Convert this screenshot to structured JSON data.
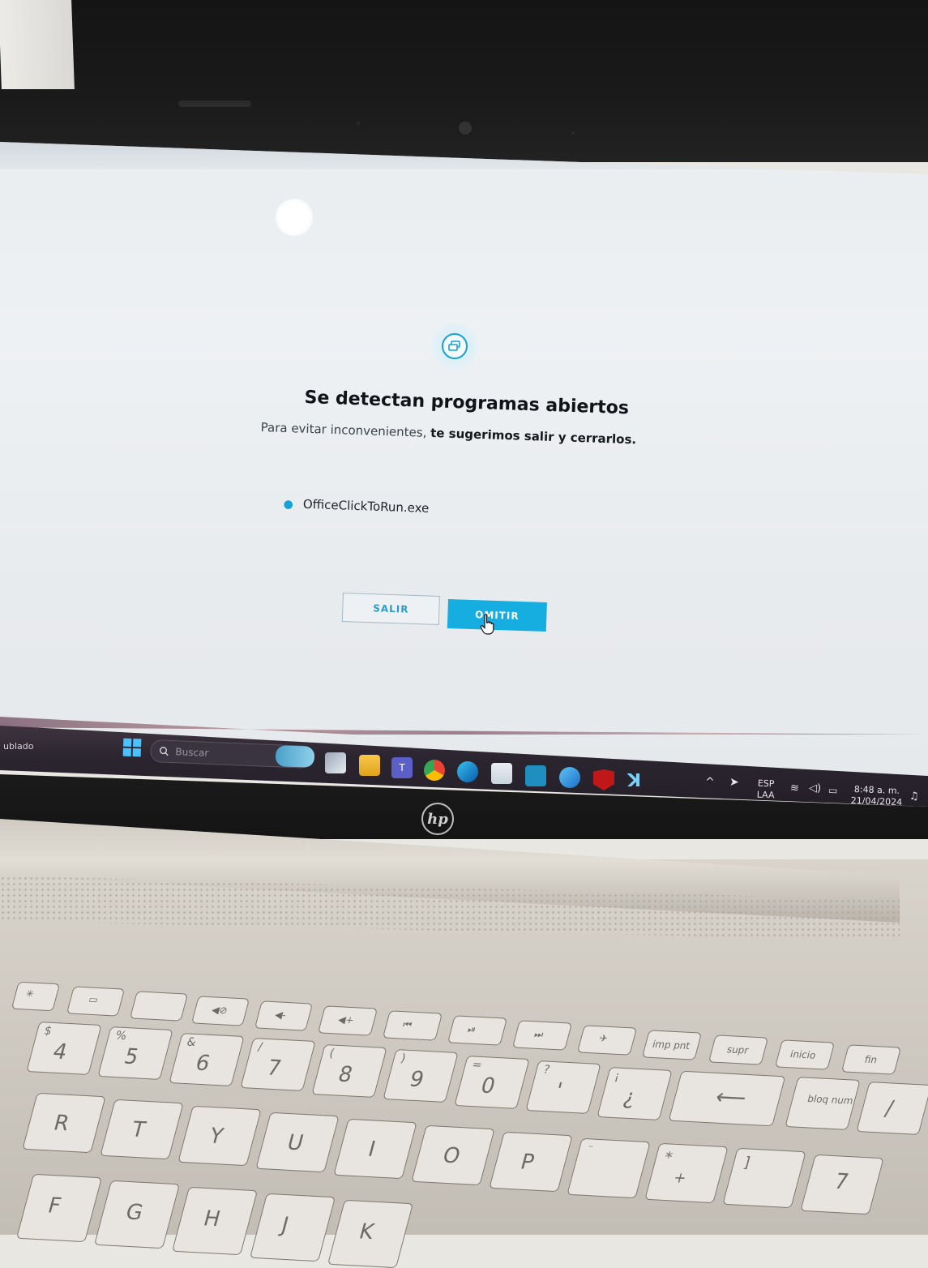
{
  "dialog": {
    "icon": "stacked-windows-icon",
    "title": "Se detectan programas abiertos",
    "subtitle_plain": "Para evitar inconvenientes,",
    "subtitle_bold": "te sugerimos salir y cerrarlos.",
    "programs": [
      "OfficeClickToRun.exe"
    ],
    "buttons": {
      "exit": "SALIR",
      "skip": "OMITIR"
    },
    "accent_color": "#16aee0"
  },
  "taskbar": {
    "weather": "ublado",
    "search_placeholder": "Buscar",
    "language": "ESP",
    "layout": "LAA",
    "time": "8:48 a. m.",
    "date": "21/04/2024"
  },
  "device": {
    "logo": "hp"
  },
  "keyboard": {
    "fn_row": [
      "imp pnt",
      "supr",
      "inicio",
      "fin"
    ],
    "number_row": [
      {
        "top": "$",
        "main": "4"
      },
      {
        "top": "%",
        "main": "5"
      },
      {
        "top": "&",
        "main": "6"
      },
      {
        "top": "/",
        "main": "7"
      },
      {
        "top": "(",
        "main": "8"
      },
      {
        "top": ")",
        "main": "9"
      },
      {
        "top": "=",
        "main": "0"
      },
      {
        "top": "?",
        "main": "'"
      },
      {
        "top": "¡",
        "main": "¿"
      }
    ],
    "letter_row": [
      "R",
      "T",
      "Y",
      "U",
      "I",
      "O",
      "P"
    ],
    "bottom_row": [
      "F",
      "G",
      "H",
      "J",
      "K"
    ],
    "bloq_num": "bloq num",
    "numpad_7": "7",
    "numpad_slash": "/"
  }
}
